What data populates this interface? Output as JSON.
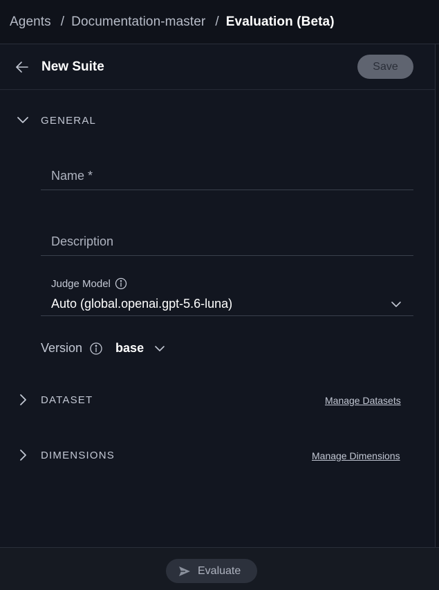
{
  "breadcrumb": {
    "items": [
      "Agents",
      "Documentation-master",
      "Evaluation (Beta)"
    ],
    "separator": "/"
  },
  "header": {
    "title": "New Suite",
    "save_label": "Save",
    "back_icon": "arrow-left-icon"
  },
  "general": {
    "label": "GENERAL",
    "name_placeholder": "Name *",
    "description_placeholder": "Description",
    "judge_model_label": "Judge Model",
    "judge_model_value": "Auto (global.openai.gpt-5.6-luna)",
    "version_label": "Version",
    "version_value": "base"
  },
  "dataset": {
    "label": "DATASET",
    "link": "Manage Datasets"
  },
  "dimensions": {
    "label": "DIMENSIONS",
    "link": "Manage Dimensions"
  },
  "footer": {
    "evaluate_label": "Evaluate",
    "evaluate_icon": "send-icon"
  },
  "colors": {
    "background": "#0f121a",
    "panel": "#121620",
    "save_button": "#5f6470",
    "evaluate_button": "#2c313c"
  }
}
